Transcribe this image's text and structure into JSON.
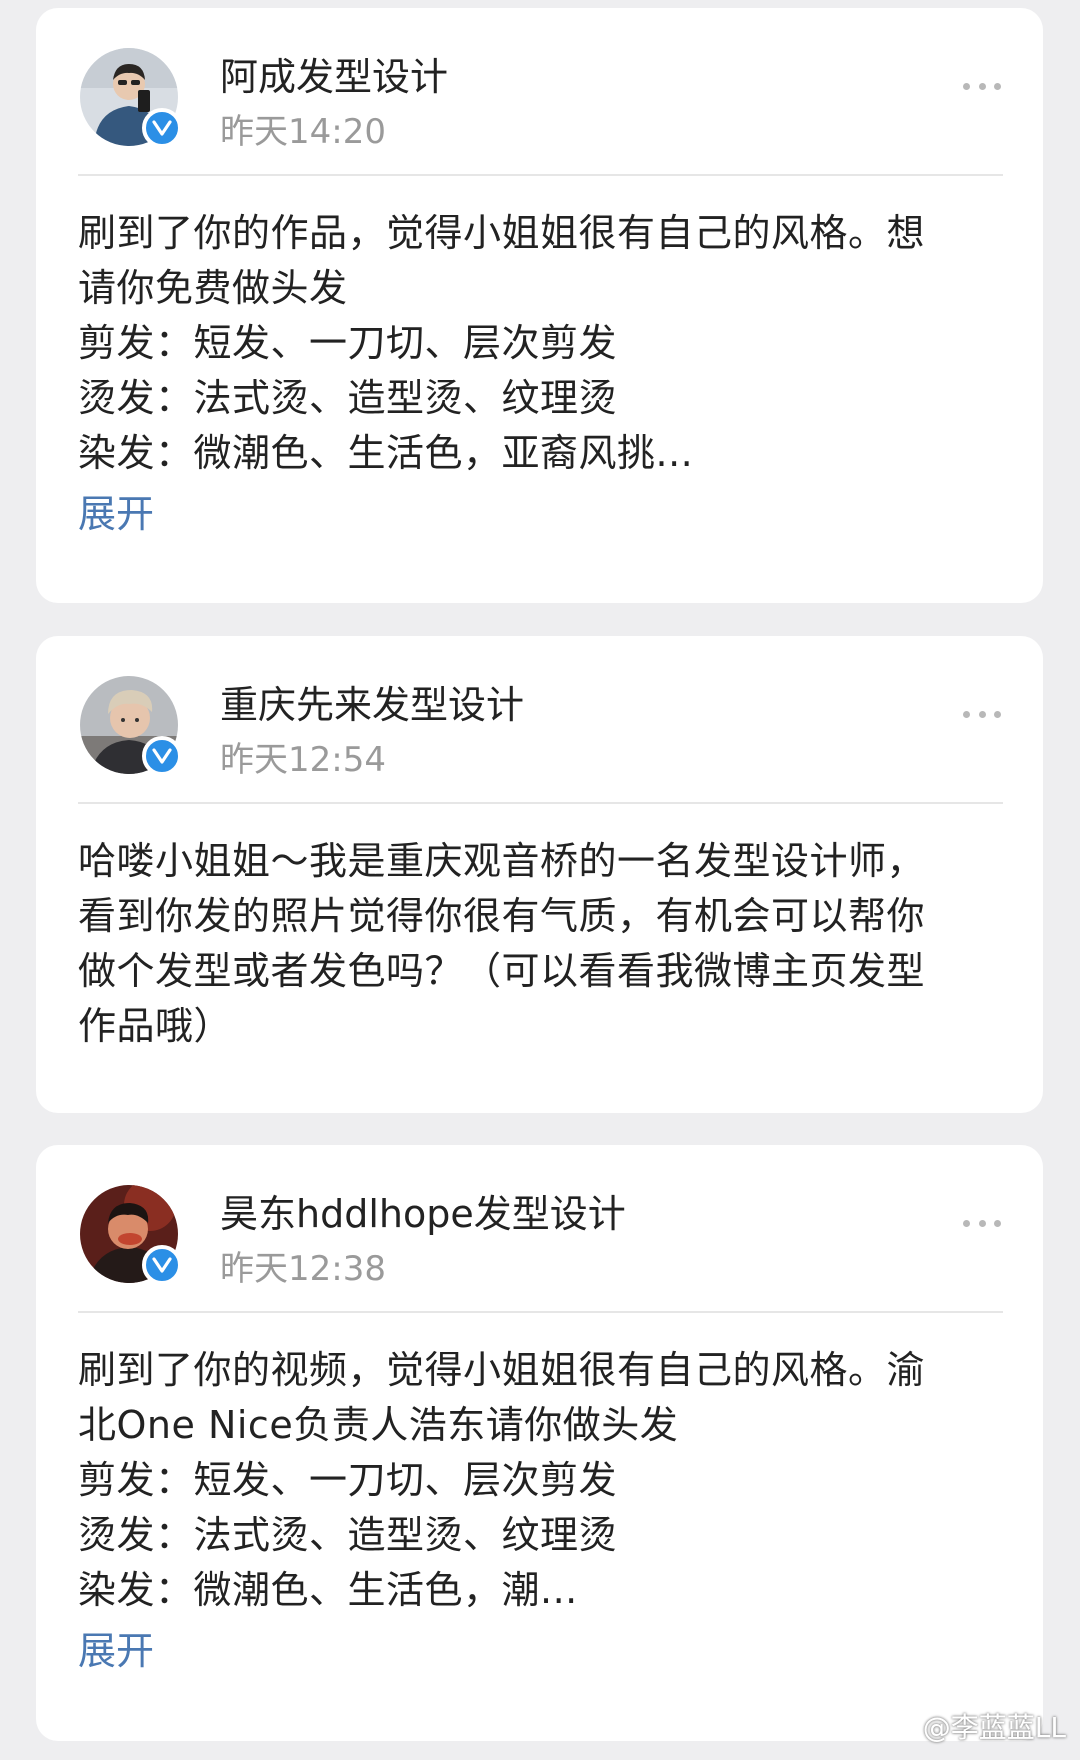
{
  "posts": [
    {
      "author": "阿成发型设计",
      "time": "昨天14:20",
      "lines": [
        "刷到了你的作品，觉得小姐姐很有自己的风格。想",
        "请你免费做头发",
        "剪发：短发、一刀切、层次剪发",
        "烫发：法式烫、造型烫、纹理烫",
        "染发：微潮色、生活色，亚裔风挑..."
      ],
      "expand_label": "展开",
      "avatar_icon": "person-avatar-icon"
    },
    {
      "author": "重庆先来发型设计",
      "time": "昨天12:54",
      "lines": [
        "哈喽小姐姐～我是重庆观音桥的一名发型设计师，",
        "看到你发的照片觉得你很有气质，有机会可以帮你",
        "做个发型或者发色吗？（可以看看我微博主页发型",
        "作品哦）"
      ],
      "avatar_icon": "person-avatar-icon"
    },
    {
      "author": "昊东hddlhope发型设计",
      "time": "昨天12:38",
      "lines": [
        "刷到了你的视频，觉得小姐姐很有自己的风格。渝",
        "北One Nice负责人浩东请你做头发",
        "剪发：短发、一刀切、层次剪发",
        "烫发：法式烫、造型烫、纹理烫",
        "染发：微潮色、生活色，潮..."
      ],
      "expand_label": "展开",
      "avatar_icon": "person-avatar-icon"
    }
  ],
  "watermark": "@李蓝蓝LL",
  "colors": {
    "background": "#eeeef0",
    "card": "#ffffff",
    "text": "#222222",
    "muted": "#9a9a9a",
    "link": "#4a78b2",
    "verified_badge": "#2b8fe6"
  },
  "icons": {
    "verified": "verified-badge-icon",
    "more": "more-options-icon",
    "watermark": "weibo-logo-icon"
  }
}
